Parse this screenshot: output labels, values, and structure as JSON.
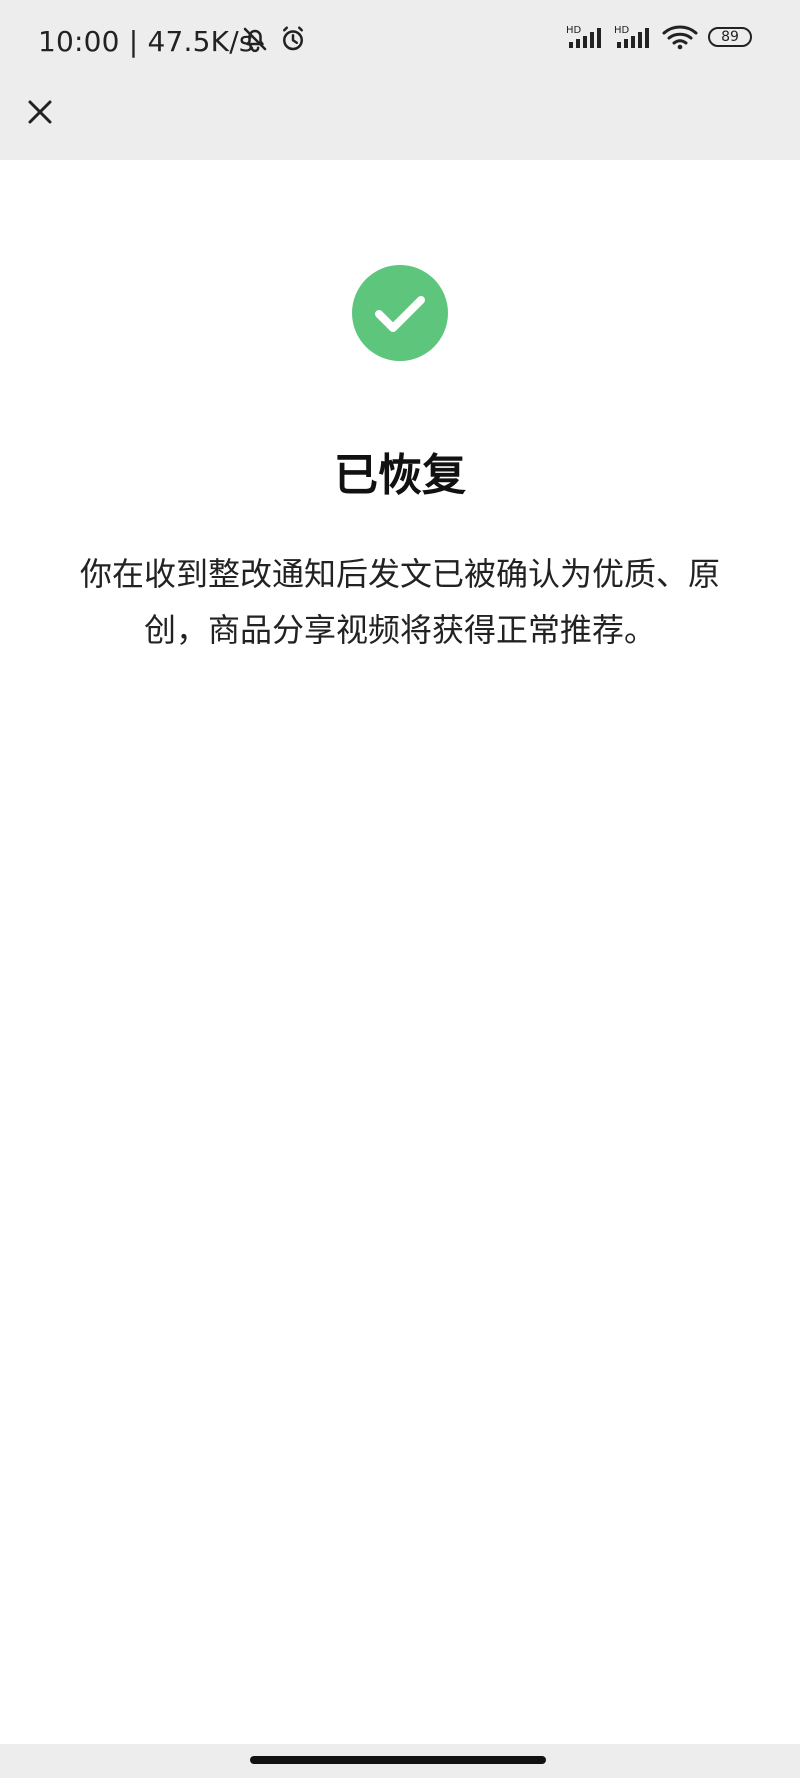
{
  "status_bar": {
    "time": "10:00 | 47.5K/s",
    "battery_level": "89",
    "icons": [
      "muted-bell-icon",
      "alarm-icon",
      "signal-hd-icon",
      "signal-hd-icon",
      "wifi-icon",
      "battery-icon"
    ]
  },
  "header": {
    "close_icon": "close-icon"
  },
  "result": {
    "icon": "check-circle-icon",
    "accent_color": "#5dc57c",
    "title": "已恢复",
    "description": "你在收到整改通知后发文已被确认为优质、原创，商品分享视频将获得正常推荐。"
  }
}
